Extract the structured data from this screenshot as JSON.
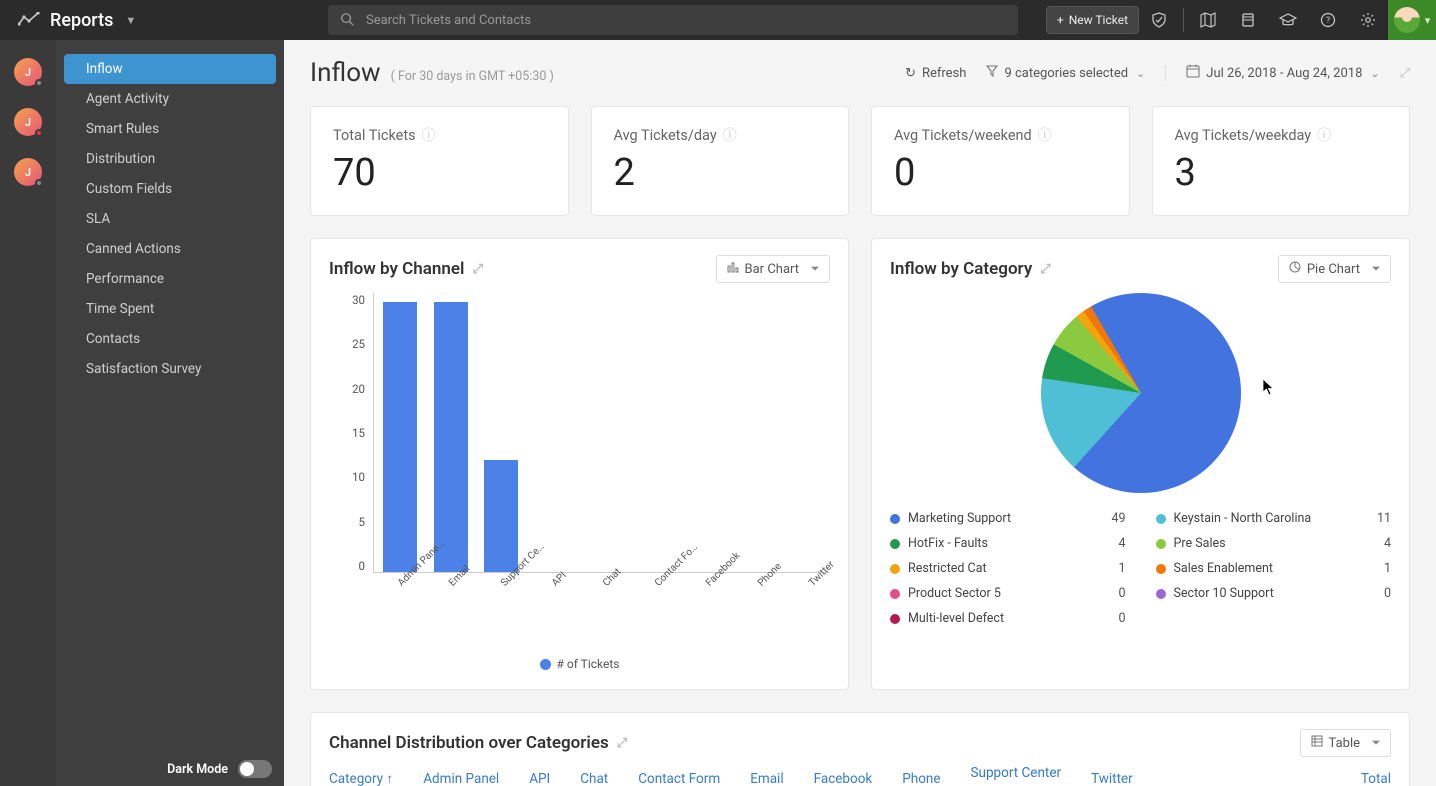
{
  "header": {
    "module": "Reports",
    "search_placeholder": "Search Tickets and Contacts",
    "new_ticket": "New Ticket"
  },
  "sidebar": {
    "items": [
      {
        "label": "Inflow",
        "active": true
      },
      {
        "label": "Agent Activity"
      },
      {
        "label": "Smart Rules"
      },
      {
        "label": "Distribution"
      },
      {
        "label": "Custom Fields"
      },
      {
        "label": "SLA"
      },
      {
        "label": "Canned Actions"
      },
      {
        "label": "Performance"
      },
      {
        "label": "Time Spent"
      },
      {
        "label": "Contacts"
      },
      {
        "label": "Satisfaction Survey"
      }
    ],
    "dark_mode": "Dark Mode"
  },
  "page": {
    "title": "Inflow",
    "subtitle": "( For 30 days in GMT +05:30 )",
    "refresh": "Refresh",
    "filter": "9 categories selected",
    "daterange": "Jul 26, 2018 - Aug 24, 2018"
  },
  "kpis": [
    {
      "label": "Total Tickets",
      "value": "70"
    },
    {
      "label": "Avg Tickets/day",
      "value": "2"
    },
    {
      "label": "Avg Tickets/weekend",
      "value": "0"
    },
    {
      "label": "Avg Tickets/weekday",
      "value": "3"
    }
  ],
  "panel_channel": {
    "title": "Inflow by Channel",
    "viewtype": "Bar Chart",
    "legend": "# of Tickets"
  },
  "panel_category": {
    "title": "Inflow by Category",
    "viewtype": "Pie Chart"
  },
  "panel_dist": {
    "title": "Channel Distribution over Categories",
    "viewtype": "Table",
    "columns": [
      "Category",
      "Admin Panel",
      "API",
      "Chat",
      "Contact Form",
      "Email",
      "Facebook",
      "Phone",
      "Support Center",
      "Twitter",
      "Total"
    ]
  },
  "chart_data": [
    {
      "id": "inflow_by_channel",
      "type": "bar",
      "ylabel": "# of Tickets",
      "ylim": [
        0,
        30
      ],
      "yticks": [
        0,
        5,
        10,
        15,
        20,
        25,
        30
      ],
      "categories": [
        "Admin Pane…",
        "Email",
        "Support Ce…",
        "API",
        "Chat",
        "Contact Fo…",
        "Facebook",
        "Phone",
        "Twitter"
      ],
      "values": [
        29,
        29,
        12,
        0,
        0,
        0,
        0,
        0,
        0
      ],
      "series_name": "# of Tickets"
    },
    {
      "id": "inflow_by_category",
      "type": "pie",
      "series": [
        {
          "name": "Marketing Support",
          "value": 49,
          "color": "#4273de"
        },
        {
          "name": "Keystain - North Carolina",
          "value": 11,
          "color": "#4fbfd6"
        },
        {
          "name": "HotFix - Faults",
          "value": 4,
          "color": "#1f9a4f"
        },
        {
          "name": "Pre Sales",
          "value": 4,
          "color": "#8bc93e"
        },
        {
          "name": "Restricted Cat",
          "value": 1,
          "color": "#f1a40b"
        },
        {
          "name": "Sales Enablement",
          "value": 1,
          "color": "#f0780a"
        },
        {
          "name": "Product Sector 5",
          "value": 0,
          "color": "#e84b8a"
        },
        {
          "name": "Sector 10 Support",
          "value": 0,
          "color": "#9a67d3"
        },
        {
          "name": "Multi-level Defect",
          "value": 0,
          "color": "#b01c4b"
        }
      ],
      "legend_layout": [
        [
          "Marketing Support",
          "Keystain - North Carolina"
        ],
        [
          "HotFix - Faults",
          "Pre Sales"
        ],
        [
          "Restricted Cat",
          "Sales Enablement"
        ],
        [
          "Product Sector 5",
          "Sector 10 Support"
        ],
        [
          "Multi-level Defect",
          null
        ]
      ]
    }
  ]
}
